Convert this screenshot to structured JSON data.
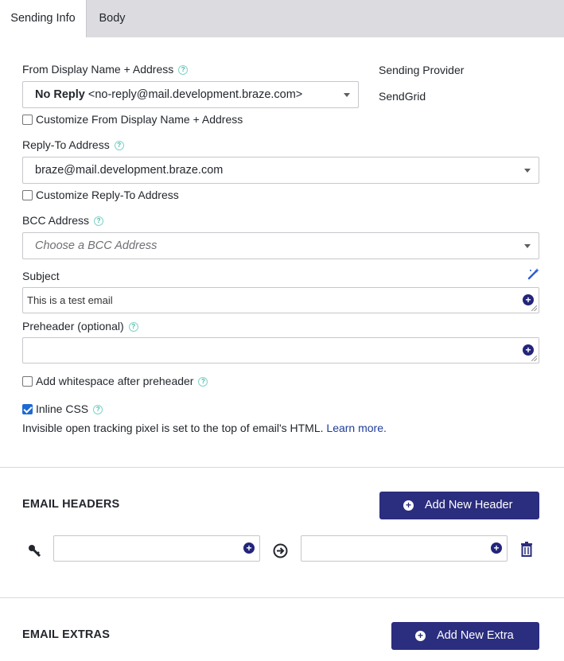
{
  "tabs": [
    {
      "label": "Sending Info",
      "active": true
    },
    {
      "label": "Body",
      "active": false
    }
  ],
  "from": {
    "label": "From Display Name + Address",
    "display_name": "No Reply",
    "address": "<no-reply@mail.development.braze.com>",
    "customize_label": "Customize From Display Name + Address",
    "customize_checked": false
  },
  "provider": {
    "label": "Sending Provider",
    "value": "SendGrid"
  },
  "reply_to": {
    "label": "Reply-To Address",
    "value": "braze@mail.development.braze.com",
    "customize_label": "Customize Reply-To Address",
    "customize_checked": false
  },
  "bcc": {
    "label": "BCC Address",
    "placeholder": "Choose a BCC Address"
  },
  "subject": {
    "label": "Subject",
    "value": "This is a test email"
  },
  "preheader": {
    "label": "Preheader (optional)",
    "value": ""
  },
  "whitespace": {
    "label": "Add whitespace after preheader",
    "checked": false
  },
  "inline_css": {
    "label": "Inline CSS",
    "checked": true,
    "note": "Invisible open tracking pixel is set to the top of email's HTML.",
    "learn_more": "Learn more."
  },
  "email_headers": {
    "title": "EMAIL HEADERS",
    "add_button": "Add New Header",
    "key_value": "",
    "value_value": ""
  },
  "email_extras": {
    "title": "EMAIL EXTRAS",
    "add_button": "Add New Extra"
  },
  "help_glyph": "?",
  "colors": {
    "accent": "#2b2d7e",
    "tab_bar": "#dcdbe0",
    "help": "#3fb6a6",
    "link": "#1f3d99",
    "checkbox_on": "#1d6ad3"
  }
}
